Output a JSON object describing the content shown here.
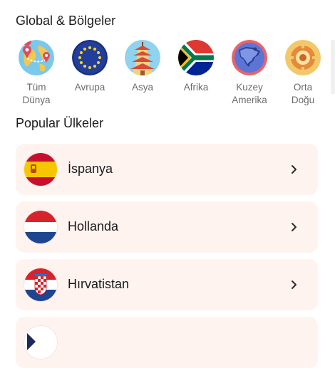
{
  "regions_section": {
    "title": "Global & Bölgeler",
    "items": [
      {
        "label_line1": "Tüm",
        "label_line2": "Dünya",
        "icon": "globe-pins-icon"
      },
      {
        "label_line1": "Avrupa",
        "label_line2": "",
        "icon": "eu-flag-icon"
      },
      {
        "label_line1": "Asya",
        "label_line2": "",
        "icon": "pagoda-icon"
      },
      {
        "label_line1": "Afrika",
        "label_line2": "",
        "icon": "south-africa-flag-icon"
      },
      {
        "label_line1": "Kuzey",
        "label_line2": "Amerika",
        "icon": "north-america-map-icon"
      },
      {
        "label_line1": "Orta",
        "label_line2": "Doğu",
        "icon": "middle-east-ornament-icon"
      }
    ]
  },
  "countries_section": {
    "title": "Popular Ülkeler",
    "items": [
      {
        "name": "İspanya",
        "flag": "spain-flag-icon"
      },
      {
        "name": "Hollanda",
        "flag": "netherlands-flag-icon"
      },
      {
        "name": "Hırvatistan",
        "flag": "croatia-flag-icon"
      },
      {
        "name": "",
        "flag": "partial-flag-icon"
      }
    ]
  },
  "colors": {
    "card_background": "#fff3f0",
    "label_gray": "#6b6b6b",
    "text_dark": "#1a1a1a"
  }
}
